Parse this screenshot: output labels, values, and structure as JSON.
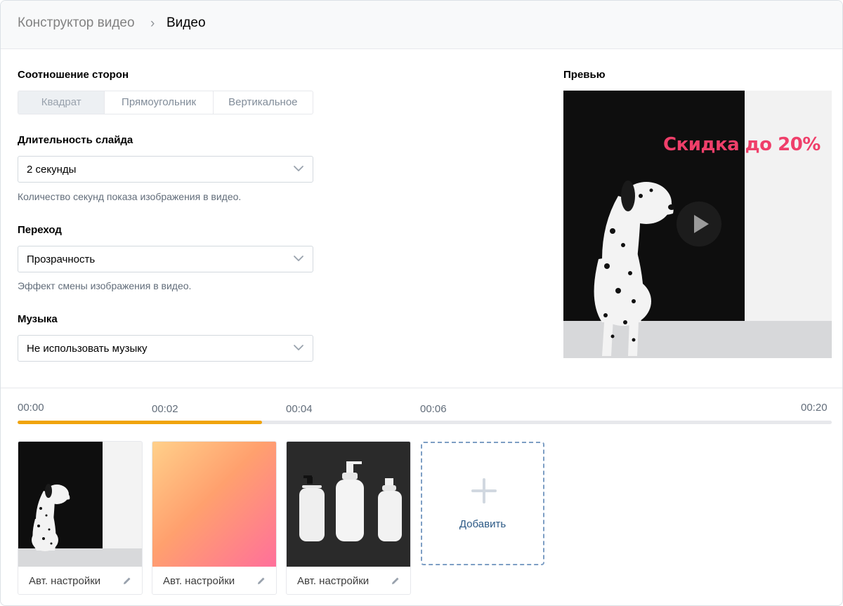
{
  "breadcrumb": {
    "parent": "Конструктор видео",
    "separator": "›",
    "current": "Видео"
  },
  "aspect": {
    "label": "Соотношение сторон",
    "options": [
      "Квадрат",
      "Прямоугольник",
      "Вертикальное"
    ],
    "selected": "Квадрат"
  },
  "duration": {
    "label": "Длительность слайда",
    "value": "2 секунды",
    "hint": "Количество секунд показа изображения в видео."
  },
  "transition": {
    "label": "Переход",
    "value": "Прозрачность",
    "hint": "Эффект смены изображения в видео."
  },
  "music": {
    "label": "Музыка",
    "value": "Не использовать музыку"
  },
  "preview": {
    "label": "Превью",
    "overlay_text": "Скидка до 20%"
  },
  "timeline": {
    "ticks": [
      "00:00",
      "00:02",
      "00:04",
      "00:06",
      "00:20"
    ],
    "progress_fraction": 0.3
  },
  "slides": [
    {
      "caption": "Авт. настройки",
      "image": "dalmatian-photo"
    },
    {
      "caption": "Авт. настройки",
      "image": "gradient"
    },
    {
      "caption": "Авт. настройки",
      "image": "bottles-photo"
    }
  ],
  "add_button": {
    "label": "Добавить"
  },
  "colors": {
    "accent_progress": "#f0a40c",
    "promo_text": "#ef3f6a",
    "link": "#2a5885"
  }
}
